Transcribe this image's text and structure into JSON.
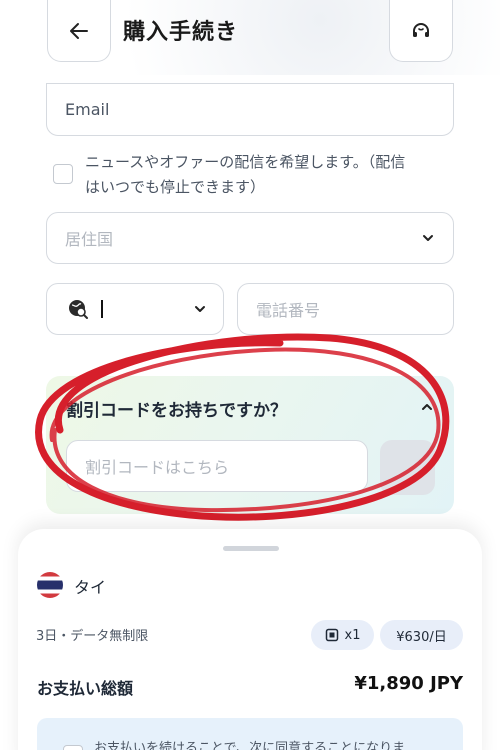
{
  "header": {
    "title": "購入手続き",
    "back_icon": "arrow-left-icon",
    "support_icon": "headset-icon"
  },
  "form": {
    "email_placeholder": "Email",
    "newsletter_label_line1": "ニュースやオファーの配信を希望します。（配信",
    "newsletter_label_line2": "はいつでも停止できます）",
    "country_placeholder": "居住国",
    "phone_placeholder": "電話番号"
  },
  "discount": {
    "title": "割引コードをお持ちですか？",
    "input_placeholder": "割引コードはこちら"
  },
  "order": {
    "country": "タイ",
    "plan": "3日・データ無制限",
    "quantity": "x1",
    "rate": "¥630/日",
    "total_label": "お支払い総額",
    "total_value": "¥1,890 JPY",
    "agreement_text": "お支払いを続けることで、次に同意することになりま"
  },
  "colors": {
    "annotation_red": "#d61f2b",
    "accent_blue": "#e8eef9"
  }
}
